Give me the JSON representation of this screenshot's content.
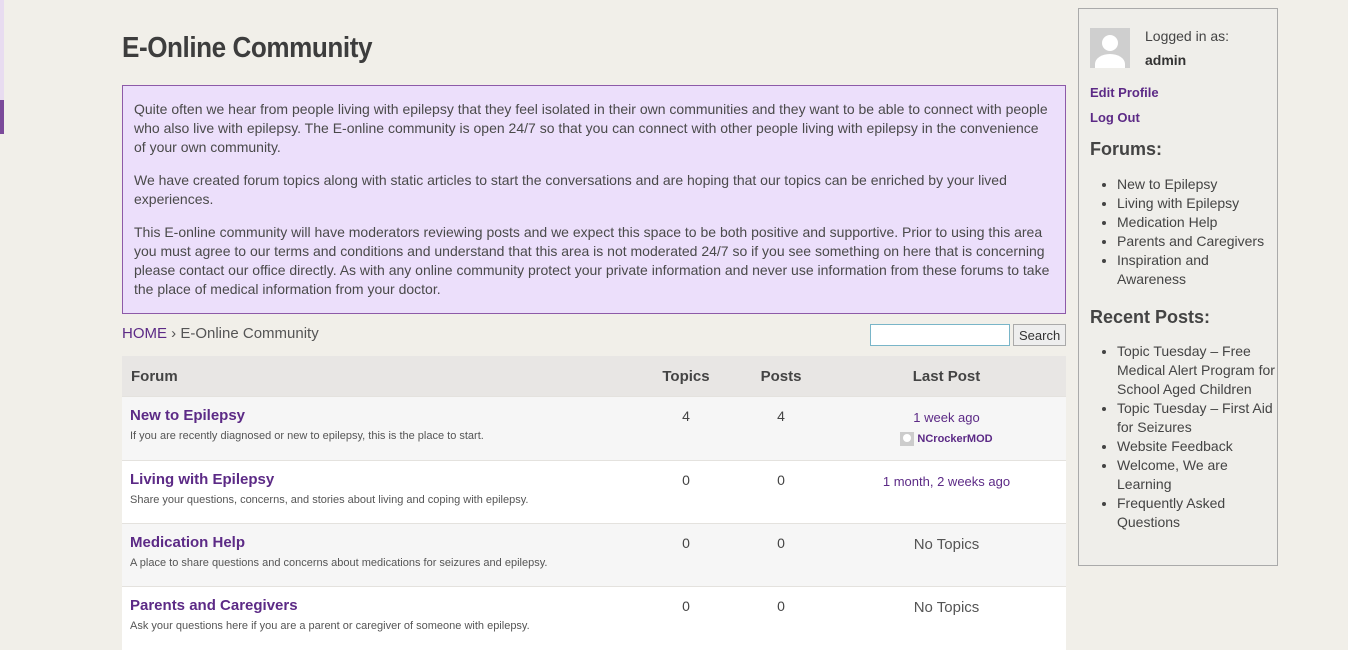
{
  "page": {
    "title": "E-Online Community"
  },
  "intro": {
    "p1": "Quite often we hear from people living with epilepsy that they feel isolated in their own communities and they want to be able to connect with people who also live with epilepsy. The E-online community is open 24/7 so that you can connect with other people living with epilepsy in the convenience of your own community.",
    "p2": "We have created forum topics along with static articles to start the conversations and are hoping that our topics can be enriched by your lived experiences.",
    "p3": "This E-online community will have moderators reviewing posts and we expect this space to be both positive and supportive. Prior to using this area you must agree to our terms and conditions and understand that this area is not moderated 24/7 so if you see something on here that is concerning please contact our office directly. As with any online community protect your private information and never use information from these forums to take the place of medical information from your doctor."
  },
  "breadcrumb": {
    "home": "HOME",
    "sep": "›",
    "current": "E-Online Community"
  },
  "search": {
    "value": "",
    "button": "Search"
  },
  "table": {
    "headers": {
      "forum": "Forum",
      "topics": "Topics",
      "posts": "Posts",
      "last": "Last Post"
    },
    "rows": [
      {
        "name": "New to Epilepsy",
        "desc": "If you are recently diagnosed or new to epilepsy, this is the place to start.",
        "topics": "4",
        "posts": "4",
        "last": "1 week ago",
        "poster": "NCrockerMOD"
      },
      {
        "name": "Living with Epilepsy",
        "desc": "Share your questions, concerns, and stories about living and coping with epilepsy.",
        "topics": "0",
        "posts": "0",
        "last": "1 month, 2 weeks ago"
      },
      {
        "name": "Medication Help",
        "desc": "A place to share questions and concerns about medications for seizures and epilepsy.",
        "topics": "0",
        "posts": "0",
        "last": "No Topics"
      },
      {
        "name": "Parents and Caregivers",
        "desc": "Ask your questions here if you are a parent or caregiver of someone with epilepsy.",
        "topics": "0",
        "posts": "0",
        "last": "No Topics"
      }
    ]
  },
  "sidebar": {
    "logged_in_label": "Logged in as:",
    "username": "admin",
    "edit_profile": "Edit Profile",
    "log_out": "Log Out",
    "forums_heading": "Forums:",
    "forums": [
      "New to Epilepsy",
      "Living with Epilepsy",
      "Medication Help",
      "Parents and Caregivers",
      "Inspiration and Awareness"
    ],
    "recent_heading": "Recent Posts:",
    "recent": [
      "Topic Tuesday – Free Medical Alert Program for School Aged Children",
      "Topic Tuesday – First Aid for Seizures",
      "Website Feedback",
      "Welcome, We are Learning",
      "Frequently Asked Questions"
    ]
  },
  "colors": {
    "accent": "#5c2a86",
    "intro_bg": "#ecdffb",
    "intro_border": "#8d5aa8"
  }
}
